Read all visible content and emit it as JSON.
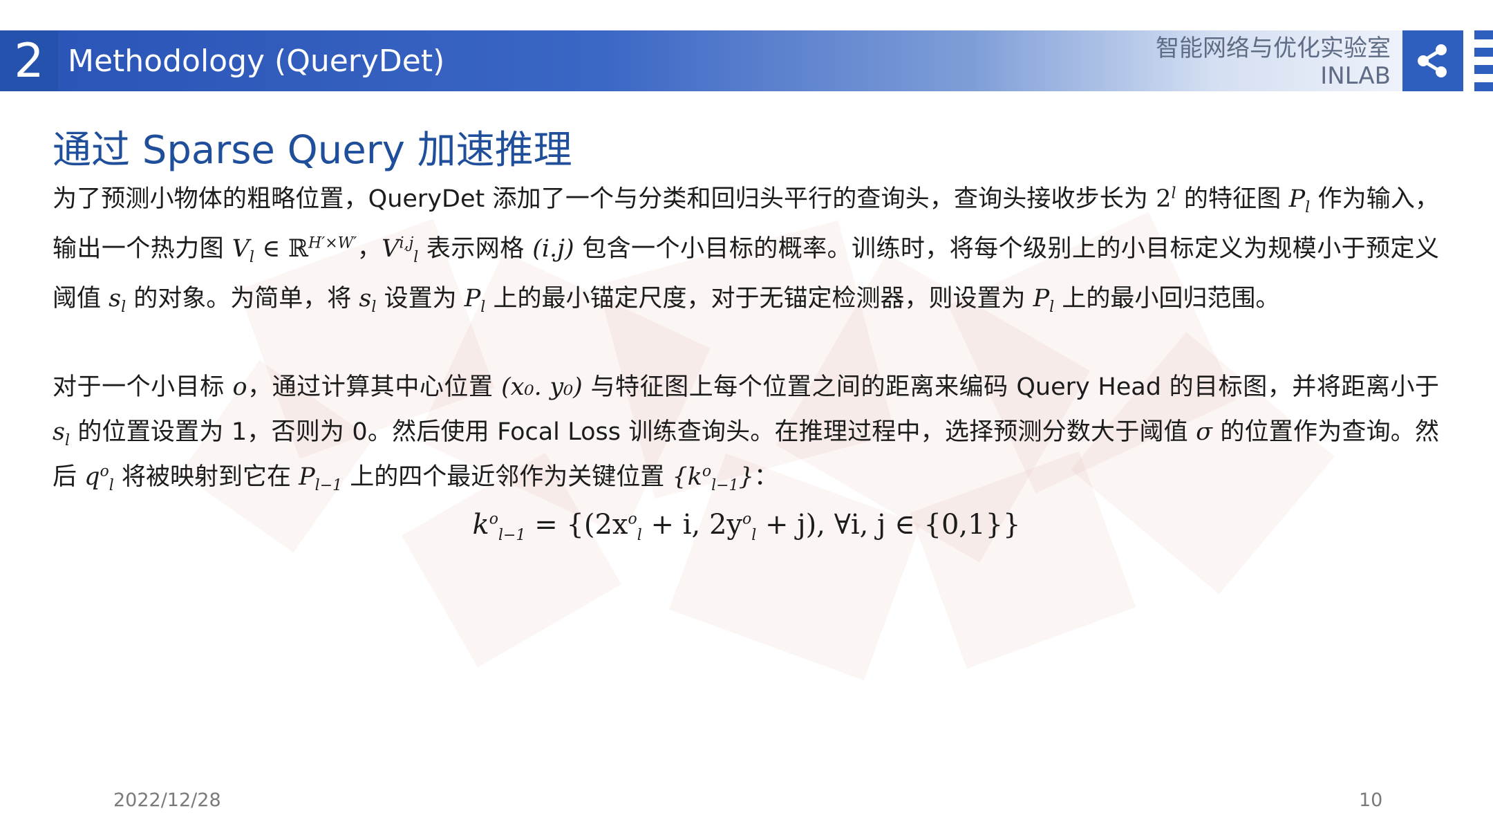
{
  "header": {
    "section_number": "2",
    "title": "Methodology (QueryDet)",
    "lab_name_cn": "智能网络与优化实验室",
    "lab_name_en": "INLAB"
  },
  "slide": {
    "heading": "通过 Sparse Query 加速推理",
    "p1": {
      "t1": "为了预测小物体的粗略位置，QueryDet 添加了一个与分类和回归头平行的查询头，查询头接收步长为 ",
      "stride_base": "2",
      "stride_exp": "l",
      "t2": " 的特征图 ",
      "feat": "P",
      "feat_sub": "l",
      "t3": " 作为输入，输出一个热力图 ",
      "heat": "V",
      "heat_sub": "l",
      "t4": " ∈ ℝ",
      "heat_dim": "H′×W′",
      "t5": "，",
      "cell": "V",
      "cell_sup": "i,j",
      "cell_sub": "l",
      "t6": " 表示网格 ",
      "grid": "(i.j)",
      "t7": " 包含一个小目标的概率。训练时，将每个级别上的小目标定义为规模小于预定义阈值 ",
      "thr": "s",
      "thr_sub": "l",
      "t8": " 的对象。为简单，将 ",
      "thr2": "s",
      "thr2_sub": "l",
      "t9": " 设置为 ",
      "p2": "P",
      "p2_sub": "l",
      "t10": " 上的最小锚定尺度，对于无锚定检测器，则设置为 ",
      "p3": "P",
      "p3_sub": "l",
      "t11": " 上的最小回归范围。"
    },
    "p2": {
      "t1": "对于一个小目标 ",
      "obj": "o",
      "t2": "，通过计算其中心位置 ",
      "center": "(x₀. y₀)",
      "t3": " 与特征图上每个位置之间的距离来编码 Query Head 的目标图，并将距离小于 ",
      "thr": "s",
      "thr_sub": "l",
      "t4": " 的位置设置为 1，否则为 0。然后使用 Focal Loss 训练查询头。在推理过程中，选择预测分数大于阈值 ",
      "sigma": "σ",
      "t5": " 的位置作为查询。然后 ",
      "q": "q",
      "q_sup": "o",
      "q_sub": "l",
      "t6": " 将被映射到它在 ",
      "pl1": "P",
      "pl1_sub": "l−1",
      "t7": " 上的四个最近邻作为关键位置 ",
      "key": "{k",
      "key_sup": "o",
      "key_sub": "l−1",
      "key_end": "}",
      "t8": "："
    },
    "formula": {
      "lhs": "k",
      "lhs_sup": "o",
      "lhs_sub": "l−1",
      "eq": " = {(2x",
      "x_sup": "o",
      "x_sub": "l",
      "mid": " + i, 2y",
      "y_sup": "o",
      "y_sub": "l",
      "rhs": " + j), ∀i, j ∈ {0,1}}"
    }
  },
  "footer": {
    "date": "2022/12/28",
    "page": "10"
  },
  "colors": {
    "header_blue": "#2b55b7",
    "heading_blue": "#1f4e9a",
    "watermark_red": "#c0392b"
  },
  "icons": {
    "share": "share-icon"
  }
}
